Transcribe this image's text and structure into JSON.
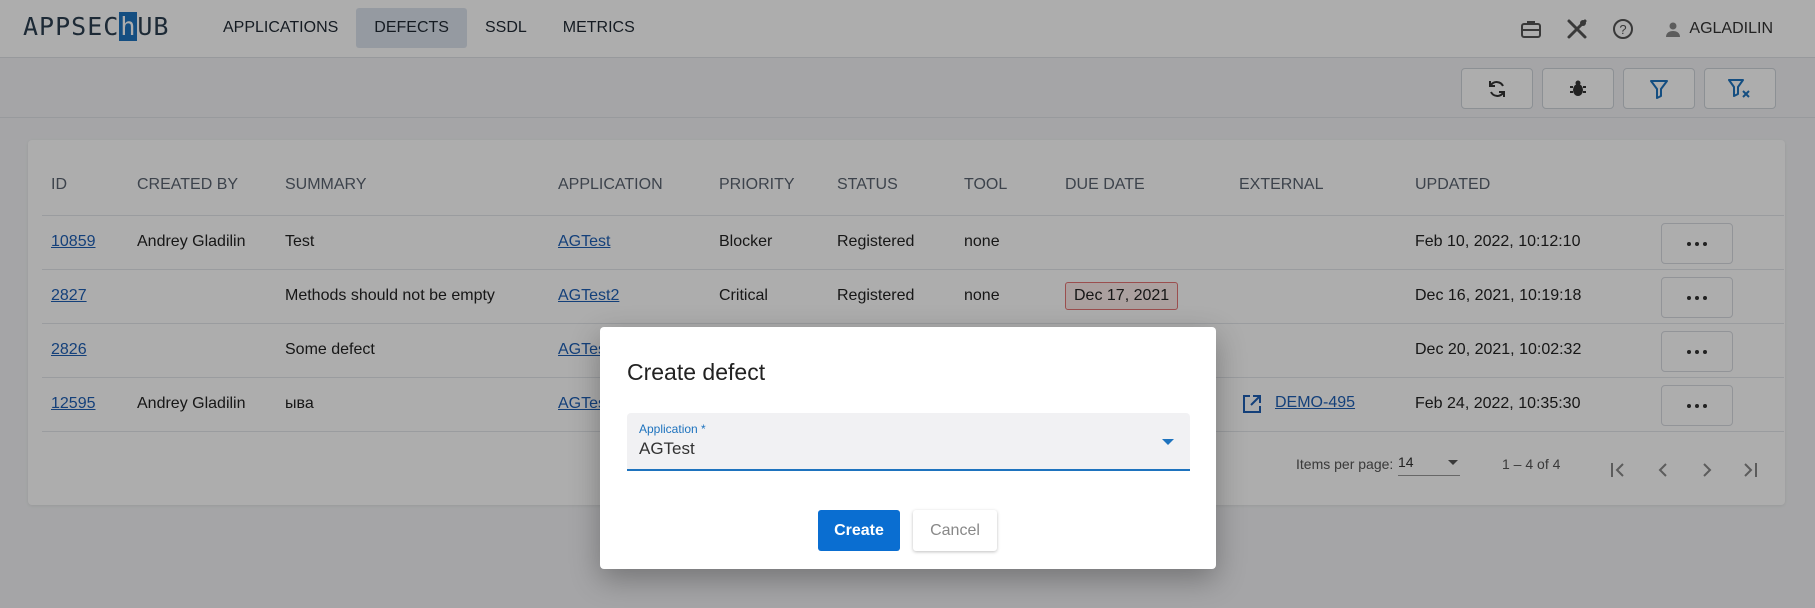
{
  "logo": {
    "before": "APPSEC",
    "box": "h",
    "after": "UB"
  },
  "nav": [
    {
      "label": "APPLICATIONS",
      "active": false
    },
    {
      "label": "DEFECTS",
      "active": true
    },
    {
      "label": "SSDL",
      "active": false
    },
    {
      "label": "METRICS",
      "active": false
    }
  ],
  "header_icons": [
    "briefcase-icon",
    "tools-icon",
    "help-icon"
  ],
  "user": {
    "name": "AGLADILIN",
    "icon": "person-icon"
  },
  "toolbar_buttons": [
    "refresh-icon",
    "bug-icon",
    "filter-icon",
    "clear-filter-icon"
  ],
  "table": {
    "headers": [
      "ID",
      "CREATED BY",
      "SUMMARY",
      "APPLICATION",
      "PRIORITY",
      "STATUS",
      "TOOL",
      "DUE DATE",
      "EXTERNAL",
      "UPDATED"
    ],
    "rows": [
      {
        "id": "10859",
        "created_by": "Andrey Gladilin",
        "summary": "Test",
        "application": "AGTest",
        "priority": "Blocker",
        "status": "Registered",
        "tool": "none",
        "due_date": "",
        "external": "",
        "updated": "Feb 10, 2022, 10:12:10"
      },
      {
        "id": "2827",
        "created_by": "",
        "summary": "Methods should not be empty",
        "application": "AGTest2",
        "priority": "Critical",
        "status": "Registered",
        "tool": "none",
        "due_date": "Dec 17, 2021",
        "external": "",
        "updated": "Dec 16, 2021, 10:19:18"
      },
      {
        "id": "2826",
        "created_by": "",
        "summary": "Some defect",
        "application": "AGTest",
        "priority": "",
        "status": "",
        "tool": "",
        "due_date": "",
        "external": "",
        "updated": "Dec 20, 2021, 10:02:32"
      },
      {
        "id": "12595",
        "created_by": "Andrey Gladilin",
        "summary": "ыва",
        "application": "AGTest",
        "priority": "",
        "status": "",
        "tool": "",
        "due_date": "",
        "external": "DEMO-495",
        "updated": "Feb 24, 2022, 10:35:30"
      }
    ]
  },
  "pagination": {
    "items_per_page_label": "Items per page:",
    "items_per_page": "14",
    "range": "1 – 4 of 4"
  },
  "dialog": {
    "title": "Create defect",
    "field_label": "Application *",
    "field_value": "AGTest",
    "create_label": "Create",
    "cancel_label": "Cancel"
  },
  "colors": {
    "accent": "#0a6ed1",
    "link": "#1e5fb4",
    "due_border": "#e57373"
  }
}
